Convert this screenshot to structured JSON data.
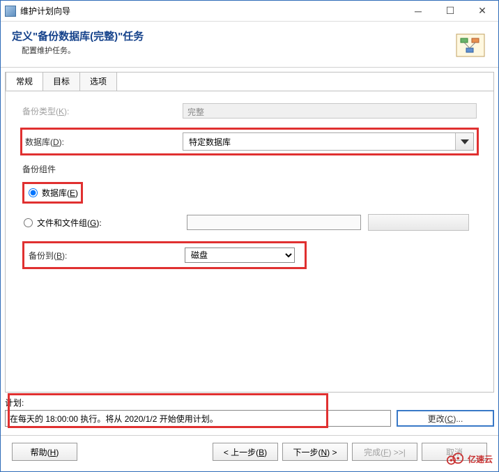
{
  "window": {
    "title": "维护计划向导"
  },
  "header": {
    "title": "定义\"备份数据库(完整)\"任务",
    "subtitle": "配置维护任务。"
  },
  "tabs": {
    "general": "常规",
    "target": "目标",
    "options": "选项"
  },
  "form": {
    "backup_type_label": "备份类型(K):",
    "backup_type_value": "完整",
    "database_label": "数据库(D):",
    "database_value": "特定数据库",
    "component_label": "备份组件",
    "radio_db": "数据库(E)",
    "radio_files": "文件和文件组(G):",
    "backup_to_label": "备份到(B):",
    "backup_to_value": "磁盘"
  },
  "schedule": {
    "label": "计划:",
    "value": "在每天的 18:00:00 执行。将从 2020/1/2 开始使用计划。",
    "change_btn": "更改(C)..."
  },
  "footer": {
    "help": "帮助(H)",
    "back": "< 上一步(B)",
    "next": "下一步(N) >",
    "finish": "完成(F) >>|",
    "cancel": "取消"
  },
  "watermark": "亿速云"
}
